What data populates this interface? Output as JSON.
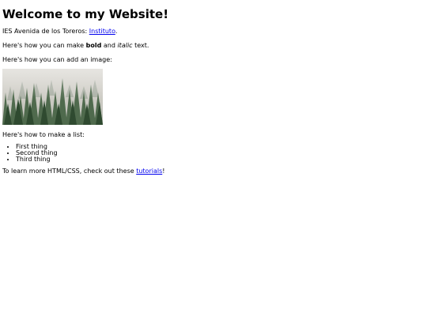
{
  "page": {
    "heading": "Welcome to my Website!",
    "institution_prefix": "IES Avenida de los Toreros: ",
    "institution_link": "Instituto",
    "institution_suffix": ".",
    "format_prefix": "Here's how you can make ",
    "bold_word": "bold",
    "format_middle": " and ",
    "italic_word": "italic",
    "format_suffix": " text.",
    "image_intro": "Here's how you can add an image:",
    "list_intro": "Here's how to make a list:",
    "list_items": [
      "First thing",
      "Second thing",
      "Third thing"
    ],
    "learn_prefix": "To learn more HTML/CSS, check out these ",
    "learn_link": "tutorials",
    "learn_suffix": "!"
  },
  "image": {
    "icon": "forest-photo"
  },
  "colors": {
    "link": "#0000ee",
    "text": "#000000",
    "background": "#ffffff"
  }
}
